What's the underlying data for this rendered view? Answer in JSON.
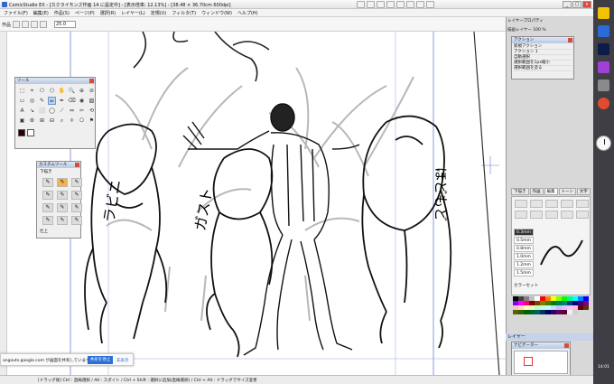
{
  "window": {
    "title": "ComicStudio EX - [カクライモンズ作画 14 に設定中] - [表示倍率: 12.13%] - [38.48 × 36.70cm 600dpi]",
    "minimize": "_",
    "maximize": "□",
    "close": "x"
  },
  "menu": [
    "ファイル(F)",
    "編集(E)",
    "作品(S)",
    "ページ(P)",
    "選択(R)",
    "レイヤー(L)",
    "定規(U)",
    "フィルタ(T)",
    "ウィンドウ(W)",
    "ヘルプ(H)"
  ],
  "toolbar": {
    "mode_label": "作品",
    "zoom_value": "25.0"
  },
  "canvas_text": {
    "left_creature": "ラビニ",
    "middle_creature": "ガスト",
    "right_creature": "ほどもど"
  },
  "tool_panel": {
    "title": "ツール",
    "tools": [
      "⬚",
      "⌖",
      "⬠",
      "⬡",
      "✋",
      "🔍",
      "⊕",
      "⊘",
      "▭",
      "◎",
      "✎",
      "✏",
      "✒",
      "⌫",
      "◉",
      "▧",
      "A",
      "↘",
      "⬜",
      "◯",
      "⟋",
      "⇔",
      "✂",
      "⟲",
      "▣",
      "⚙",
      "⊞",
      "⊟",
      "⌕",
      "⌾",
      "⎔",
      "⚑"
    ]
  },
  "custom_tools": {
    "title": "カスタムツール",
    "tab": "下描き",
    "items": [
      "✎",
      "✎",
      "✎",
      "✎",
      "✎",
      "✎",
      "✎",
      "✎",
      "✎",
      "✎",
      "✎",
      "✎"
    ],
    "section_label": "仕上"
  },
  "colors": {
    "accent": "#2b6fd6",
    "main_color": "#2a0000",
    "sub_color": "#ffffff"
  },
  "right_panels": {
    "layer_property": "レイヤープロパティ",
    "action_title": "アクション",
    "action_items": [
      "新規アクション",
      "アクション 1",
      "自動選択",
      "選択範囲を1px縮小",
      "選択範囲を塗る"
    ],
    "layer_row": "描画レイヤー",
    "zoom": "100 %",
    "tabs": [
      "下描き",
      "作画",
      "編集",
      "トーン",
      "文字"
    ],
    "brush_sizes": [
      "0.3mm",
      "0.5mm",
      "0.8mm",
      "1.0mm",
      "1.2mm",
      "1.5mm"
    ],
    "color_set_label": "カラーセット",
    "layer_panel_title": "レイヤー",
    "navigator_title": "ナビゲーター"
  },
  "status": "[ドラッグ後] Ctrl : 直線選択 / Alt : スポイト / Ctrl + Shift : 選択に追加(直線選択) / Ctrl + Alt : ドラッグでサイズ変更",
  "share_bar": {
    "text": "angouts.google.com が画面を共有しています。",
    "stop": "共有を停止",
    "hide": "非表示"
  },
  "taskbar": {
    "time": "14:01"
  },
  "palette": [
    "#000000",
    "#404040",
    "#808080",
    "#c0c0c0",
    "#ffffff",
    "#ff0000",
    "#ff8000",
    "#ffff00",
    "#80ff00",
    "#00ff00",
    "#00ff80",
    "#00ffff",
    "#0080ff",
    "#0000ff",
    "#8000ff",
    "#ff00ff",
    "#ff0080",
    "#800000",
    "#804000",
    "#808000",
    "#408000",
    "#008000",
    "#008040",
    "#008080",
    "#004080",
    "#000080",
    "#400080",
    "#800080",
    "#ffc0c0",
    "#ffe0c0",
    "#ffffc0",
    "#e0ffc0",
    "#c0ffc0",
    "#c0ffe0",
    "#c0ffff",
    "#c0e0ff",
    "#c0c0ff",
    "#e0c0ff",
    "#ffc0ff",
    "#ffc0e0",
    "#600000",
    "#603000",
    "#606000",
    "#306000",
    "#006000",
    "#006030",
    "#006060",
    "#003060",
    "#000060",
    "#300060",
    "#600060",
    "#600030",
    "#f0f0f0",
    "#d0d0d0"
  ]
}
